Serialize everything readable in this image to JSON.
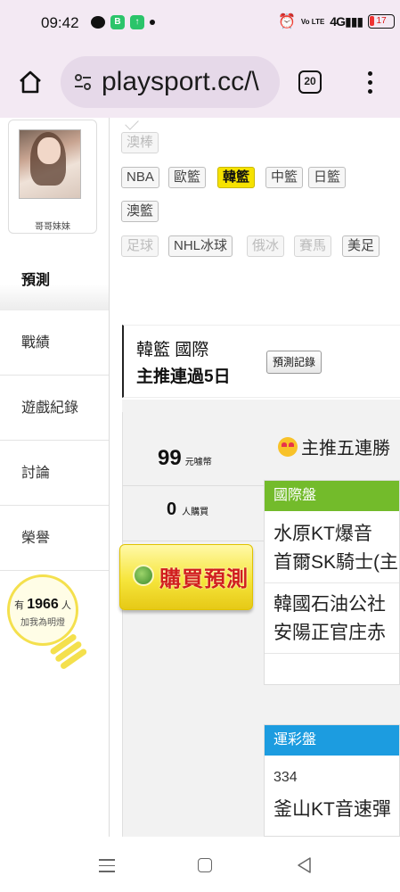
{
  "status_bar": {
    "time": "09:42",
    "battery": "17",
    "signal_text": "4G",
    "volte_text": "Vo LTE"
  },
  "browser": {
    "url": "playsport.cc/\\",
    "tab_count": "20"
  },
  "profile": {
    "name": "哥哥妹妹"
  },
  "sidebar": {
    "items": [
      {
        "label": "預測"
      },
      {
        "label": "戰績"
      },
      {
        "label": "遊戲紀錄"
      },
      {
        "label": "討論"
      },
      {
        "label": "榮譽"
      }
    ]
  },
  "bulb": {
    "prefix": "有",
    "count": "1966",
    "suffix": "人",
    "sub": "加我為明燈"
  },
  "tags": {
    "row0": [
      "澳棒"
    ],
    "row1": [
      "NBA",
      "歐籃",
      "韓籃",
      "中籃",
      "日籃"
    ],
    "row2": [
      "澳籃"
    ],
    "row3": [
      "足球",
      "NHL冰球",
      "俄冰",
      "賽馬",
      "美足"
    ]
  },
  "section": {
    "line1": "韓籃 國際",
    "line2": "主推連過5日",
    "record_button": "預測記錄"
  },
  "purchase": {
    "price": "99",
    "price_unit": "元噱幣",
    "buyers": "0",
    "buyers_unit": "人購買",
    "buy_button": "購買預測"
  },
  "streak": {
    "text": "主推五連勝"
  },
  "international": {
    "header": "國際盤",
    "match1_home": "水原KT爆音",
    "match1_away": "首爾SK騎士(主",
    "match2_home": "韓國石油公社",
    "match2_away": "安陽正官庄赤"
  },
  "lottery": {
    "header": "運彩盤",
    "number": "334",
    "team": "釜山KT音速彈"
  },
  "colors": {
    "accent_yellow": "#f6e200",
    "green_header": "#73bb2b",
    "blue_header": "#1c9ce0",
    "buy_text": "#d11e1e"
  }
}
